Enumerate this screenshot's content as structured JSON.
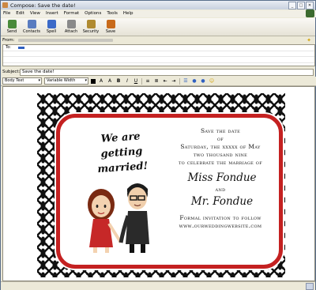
{
  "window": {
    "title": "Compose: Save the date!"
  },
  "menu": [
    "File",
    "Edit",
    "View",
    "Insert",
    "Format",
    "Options",
    "Tools",
    "Help"
  ],
  "toolbar": [
    {
      "label": "Send",
      "icon": "send-icon",
      "color": "#4a8a3a"
    },
    {
      "label": "Contacts",
      "icon": "contacts-icon",
      "color": "#5a7cc0"
    },
    {
      "label": "Spell",
      "icon": "spell-icon",
      "color": "#3c6ac8"
    },
    {
      "label": "Attach",
      "icon": "attach-icon",
      "color": "#8a8a8a"
    },
    {
      "label": "Security",
      "icon": "security-icon",
      "color": "#b08a30"
    },
    {
      "label": "Save",
      "icon": "save-icon",
      "color": "#c86a1a"
    }
  ],
  "from": {
    "label": "From:"
  },
  "to": {
    "label": "To:"
  },
  "subject": {
    "label": "Subject:",
    "value": "Save the date!"
  },
  "format": {
    "paragraph": "Body Text",
    "font": "Variable Width"
  },
  "card": {
    "left_text": "We are getting married!",
    "line1": "Save the date",
    "line2": "of",
    "line3": "Saturday, the xxxxx of May",
    "line4": "two thousand nine",
    "line5": "to celebrate the marriage of",
    "name1": "Miss Fondue",
    "and": "and",
    "name2": "Mr. Fondue",
    "line6": "Formal invitation to follow",
    "line7": "www.ourweddingwebsite.com"
  },
  "colors": {
    "card_border": "#c42121",
    "accent": "#3060c0"
  }
}
